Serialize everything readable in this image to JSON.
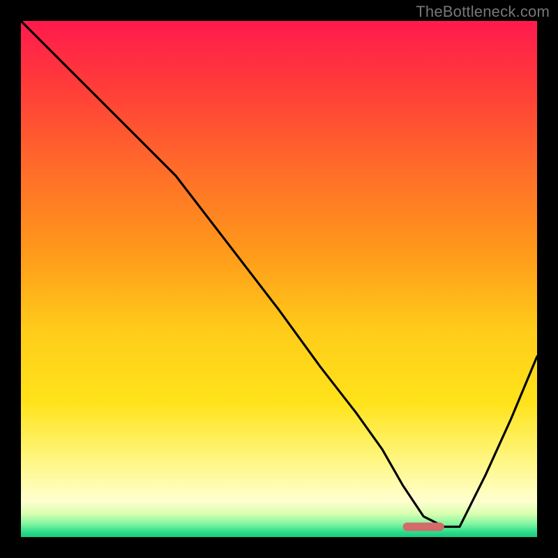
{
  "watermark": "TheBottleneck.com",
  "chart_data": {
    "type": "line",
    "title": "",
    "xlabel": "",
    "ylabel": "",
    "xlim": [
      0,
      100
    ],
    "ylim": [
      0,
      100
    ],
    "background_gradient": {
      "direction": "vertical",
      "stops": [
        {
          "pos": 0.0,
          "color": "#ff1a4d"
        },
        {
          "pos": 0.12,
          "color": "#ff3a3a"
        },
        {
          "pos": 0.28,
          "color": "#ff6a2a"
        },
        {
          "pos": 0.45,
          "color": "#ff9a1a"
        },
        {
          "pos": 0.6,
          "color": "#ffcc1a"
        },
        {
          "pos": 0.74,
          "color": "#ffe31a"
        },
        {
          "pos": 0.86,
          "color": "#fff88a"
        },
        {
          "pos": 0.93,
          "color": "#ffffcf"
        },
        {
          "pos": 0.955,
          "color": "#d8ffb0"
        },
        {
          "pos": 0.975,
          "color": "#7ff5a0"
        },
        {
          "pos": 0.99,
          "color": "#2edc8a"
        },
        {
          "pos": 1.0,
          "color": "#17c97e"
        }
      ]
    },
    "curve": {
      "x": [
        0,
        8,
        22,
        30,
        40,
        50,
        58,
        65,
        70,
        74,
        78,
        82,
        85,
        90,
        95,
        100
      ],
      "y": [
        100,
        92,
        78,
        70,
        57,
        44,
        33,
        24,
        17,
        10,
        4,
        2,
        2,
        12,
        23,
        35
      ]
    },
    "marker": {
      "x_start": 74,
      "x_end": 82,
      "y": 2,
      "color": "#d46a6a"
    }
  }
}
